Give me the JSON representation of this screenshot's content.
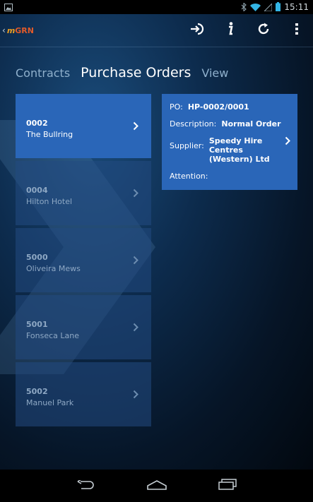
{
  "status_bar": {
    "time": "15:11",
    "icons": [
      "gallery-icon",
      "bluetooth-icon",
      "wifi-icon",
      "signal-icon",
      "battery-icon"
    ]
  },
  "app": {
    "logo_prefix": "m",
    "logo_suffix": "GRN"
  },
  "toolbar": {
    "actions": [
      "login-icon",
      "info-icon",
      "refresh-icon",
      "overflow-menu-icon"
    ]
  },
  "tabs": [
    {
      "label": "Contracts",
      "active": false
    },
    {
      "label": "Purchase Orders",
      "active": true
    },
    {
      "label": "View",
      "active": false
    }
  ],
  "orders": [
    {
      "code": "0002",
      "name": "The Bullring",
      "selected": true
    },
    {
      "code": "0004",
      "name": "Hilton Hotel",
      "selected": false
    },
    {
      "code": "5000",
      "name": "Oliveira Mews",
      "selected": false
    },
    {
      "code": "5001",
      "name": "Fonseca Lane",
      "selected": false
    },
    {
      "code": "5002",
      "name": "Manuel Park",
      "selected": false
    }
  ],
  "details": {
    "po_label": "PO:",
    "po_value": "HP-0002/0001",
    "description_label": "Description:",
    "description_value": "Normal Order",
    "supplier_label": "Supplier:",
    "supplier_value": "Speedy Hire Centres (Western) Ltd",
    "attention_label": "Attention:",
    "attention_value": ""
  },
  "colors": {
    "selected_tile": "#2a66b8",
    "unselected_tile": "#1e4475",
    "logo_accent": "#e05a2a"
  },
  "navigation": [
    "back-icon",
    "home-icon",
    "recent-apps-icon"
  ]
}
